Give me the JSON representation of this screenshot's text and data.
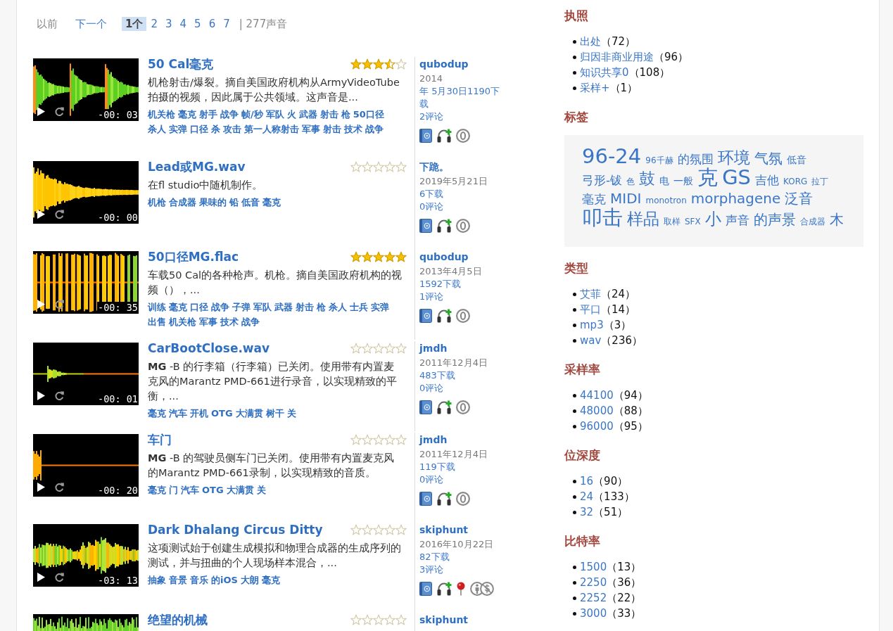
{
  "pagination": {
    "previous": {
      "label": "以前",
      "disabled": true
    },
    "next": {
      "label": "下一个",
      "disabled": false
    },
    "pages": [
      {
        "label": "1个",
        "selected": true
      },
      {
        "label": "2",
        "selected": false
      },
      {
        "label": "3",
        "selected": false
      },
      {
        "label": "4",
        "selected": false
      },
      {
        "label": "5",
        "selected": false
      },
      {
        "label": "6",
        "selected": false
      },
      {
        "label": "7",
        "selected": false
      }
    ],
    "total": "| 277声音"
  },
  "results": [
    {
      "title": "50 Cal毫克",
      "stars": 3.5,
      "duration": "-00: 03",
      "description": "机枪射击/爆裂。摘自美国政府机构从ArmyVideoTube拍摄的视频，因此属于公共领域。这声音是...",
      "tags": [
        "机关枪",
        "毫克",
        "射手",
        "战争",
        "帧/秒",
        "军队",
        "火",
        "武器",
        "射击",
        "枪",
        "50口径",
        "杀人",
        "实弹",
        "口径",
        "杀",
        "攻击",
        "第一人称射击",
        "军事",
        "射击",
        "技术",
        "战争"
      ],
      "user": "qubodup",
      "date": "2014",
      "downloads": "年 5月30日1190下载",
      "comments": "2评论",
      "license": {
        "kind": "cc0"
      },
      "geotagged": false
    },
    {
      "title": "Lead或MG.wav",
      "stars": 0,
      "duration": "-00: 00",
      "description": "在fl studio中随机制作。",
      "tags": [
        "机枪",
        "合成器",
        "果味的",
        "铅",
        "低音",
        "毫克"
      ],
      "user": "下跪。",
      "date": "2019年5月21日",
      "downloads": "6下载",
      "comments": "0评论",
      "license": {
        "kind": "cc0"
      },
      "geotagged": false
    },
    {
      "title": "50口径MG.flac",
      "stars": 5,
      "duration": "-00: 35",
      "description": "车载50 Cal的各种枪声。机枪。摘自美国政府机构的视频（），...",
      "tags": [
        "训练",
        "毫克",
        "口径",
        "战争",
        "子弹",
        "军队",
        "武器",
        "射击",
        "枪",
        "杀人",
        "士兵",
        "实弹",
        "出售",
        "机关枪",
        "军事",
        "技术",
        "战争"
      ],
      "user": "qubodup",
      "date": "2013年4月5日",
      "downloads": "1592下载",
      "comments": "1评论",
      "license": {
        "kind": "cc0"
      },
      "geotagged": false
    },
    {
      "title": "CarBootClose.wav",
      "stars": 0,
      "duration": "-00: 01",
      "description": "**MG** -B 的行李箱（行李箱）已关闭。使用带有内置麦克风的Marantz PMD-661进行录音，以实现精致的平衡，...",
      "tags": [
        "毫克",
        "汽车",
        "开机",
        "OTG",
        "大满贯",
        "树干",
        "关"
      ],
      "user": "jmdh",
      "date": "2011年12月4日",
      "downloads": "483下载",
      "comments": "0评论",
      "license": {
        "kind": "cc0"
      },
      "geotagged": false
    },
    {
      "title": "车门",
      "stars": 0,
      "duration": "-00: 20",
      "description": "**MG** -B 的驾驶员侧车门已关闭。使用带有内置麦克风的Marantz PMD-661录制，以实现精致的音质。",
      "tags": [
        "毫克",
        "门",
        "汽车",
        "OTG",
        "大满贯",
        "关"
      ],
      "user": "jmdh",
      "date": "2011年12月4日",
      "downloads": "119下载",
      "comments": "0评论",
      "license": {
        "kind": "cc0"
      },
      "geotagged": false
    },
    {
      "title": "Dark Dhalang Circus Ditty",
      "stars": 0,
      "duration": "-03: 13",
      "description": "这项测试始于创建生成模拟和物理合成器的生成序列的测试，并与扭曲的个人现场样本混合，...",
      "tags": [
        "抽象",
        "音景",
        "音乐",
        "的iOS",
        "大朗",
        "毫克"
      ],
      "user": "skiphunt",
      "date": "2016年10月22日",
      "downloads": "82下载",
      "comments": "3评论",
      "license": {
        "kind": "bync"
      },
      "geotagged": true
    },
    {
      "title": "绝望的机械",
      "stars": 0,
      "user": "skiphunt"
    }
  ],
  "sidebar": [
    {
      "kind": "list",
      "title": "执照",
      "items": [
        {
          "label": "出处",
          "count": "（72）"
        },
        {
          "label": "归因非商业用途",
          "count": "（96）"
        },
        {
          "label": "知识共享0",
          "count": "（108）"
        },
        {
          "label": "采样+",
          "count": "（1）"
        }
      ]
    },
    {
      "kind": "cloud",
      "title": "标签",
      "tags": [
        {
          "label": "96-24",
          "kind": "xxl"
        },
        {
          "label": "96千赫",
          "kind": "xs"
        },
        {
          "label": "的氛围",
          "kind": "m"
        },
        {
          "label": "环境",
          "kind": "xl"
        },
        {
          "label": "气氛",
          "kind": "l"
        },
        {
          "label": "低音",
          "kind": "s"
        },
        {
          "label": "弓形-钹",
          "kind": "m"
        },
        {
          "label": "色",
          "kind": "xs"
        },
        {
          "label": "鼓",
          "kind": "xl"
        },
        {
          "label": "电",
          "kind": "s"
        },
        {
          "label": "一般",
          "kind": "s"
        },
        {
          "label": "克",
          "kind": "xxl"
        },
        {
          "label": "GS",
          "kind": "xxl"
        },
        {
          "label": "吉他",
          "kind": "m"
        },
        {
          "label": "KORG",
          "kind": "xs"
        },
        {
          "label": "拉丁",
          "kind": "xs"
        },
        {
          "label": "毫克",
          "kind": "m"
        },
        {
          "label": "MIDI",
          "kind": "l"
        },
        {
          "label": "monotron",
          "kind": "xs"
        },
        {
          "label": "morphagene",
          "kind": "l"
        },
        {
          "label": "泛音",
          "kind": "l"
        },
        {
          "label": "叩击",
          "kind": "xxl"
        },
        {
          "label": "样品",
          "kind": "xl"
        },
        {
          "label": "取样",
          "kind": "xs"
        },
        {
          "label": "SFX",
          "kind": "xs"
        },
        {
          "label": "小",
          "kind": "xl"
        },
        {
          "label": "声音",
          "kind": "m"
        },
        {
          "label": "的声景",
          "kind": "l"
        },
        {
          "label": "合成器",
          "kind": "xs"
        },
        {
          "label": "木",
          "kind": "l"
        }
      ]
    },
    {
      "kind": "list",
      "title": "类型",
      "items": [
        {
          "label": "艾菲",
          "count": "（24）"
        },
        {
          "label": "平口",
          "count": "（14）"
        },
        {
          "label": "mp3",
          "count": "（3）"
        },
        {
          "label": "wav",
          "count": "（236）"
        }
      ]
    },
    {
      "kind": "list",
      "title": "采样率",
      "items": [
        {
          "label": "44100",
          "count": "（94）"
        },
        {
          "label": "48000",
          "count": "（88）"
        },
        {
          "label": "96000",
          "count": "（95）"
        }
      ]
    },
    {
      "kind": "list",
      "title": "位深度",
      "items": [
        {
          "label": "16",
          "count": "（90）"
        },
        {
          "label": "24",
          "count": "（133）"
        },
        {
          "label": "32",
          "count": "（51）"
        }
      ]
    },
    {
      "kind": "list",
      "title": "比特率",
      "items": [
        {
          "label": "1500",
          "count": "（13）"
        },
        {
          "label": "2250",
          "count": "（36）"
        },
        {
          "label": "2252",
          "count": "（22）"
        },
        {
          "label": "3000",
          "count": "（33）"
        }
      ]
    }
  ]
}
